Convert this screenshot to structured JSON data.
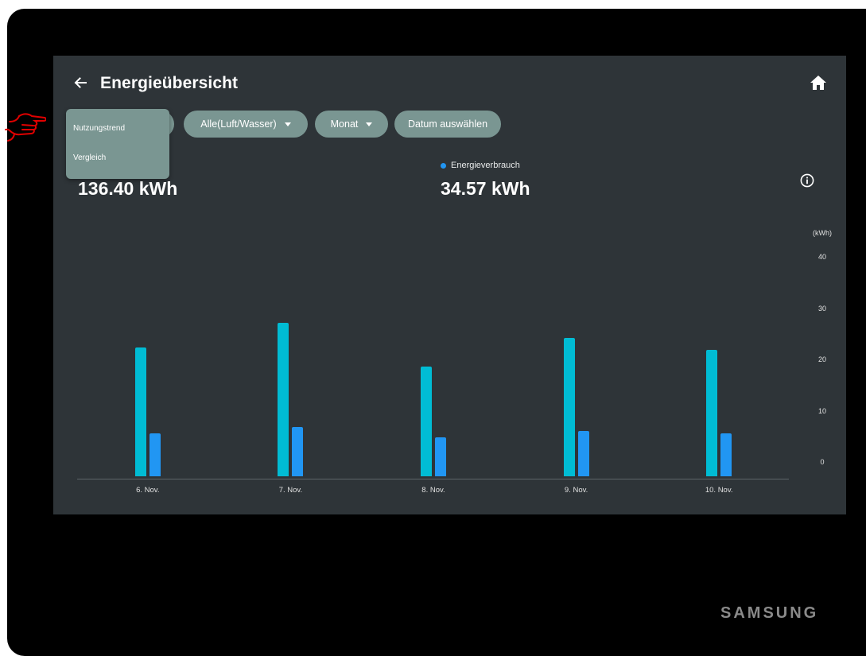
{
  "header": {
    "title": "Energieübersicht",
    "back_icon": "arrow-left-icon",
    "home_icon": "home-icon"
  },
  "filters": {
    "dropdown_menu": {
      "items": [
        "Nutzungstrend",
        "Vergleich"
      ]
    },
    "unit_filter": "Alle(Luft/Wasser)",
    "period_filter": "Monat",
    "date_button": "Datum auswählen"
  },
  "stats": {
    "left_value": "136.40 kWh",
    "right_label": "Energieverbrauch",
    "right_value": "34.57 kWh",
    "info_icon": "info-icon"
  },
  "chart_data": {
    "type": "bar",
    "categories": [
      "6. Nov.",
      "7. Nov.",
      "8. Nov.",
      "9. Nov.",
      "10. Nov."
    ],
    "series": [
      {
        "values": [
          22.5,
          27.3,
          18.7,
          24.4,
          22.0
        ]
      },
      {
        "name": "Energieverbrauch",
        "values": [
          5.7,
          6.9,
          5.0,
          6.2,
          5.7
        ]
      }
    ],
    "ylabel": "(kWh)",
    "yticks": [
      0,
      10,
      20,
      30,
      40
    ],
    "ylim": [
      0,
      40
    ],
    "y_axis_position": "right",
    "colors": [
      "#00bcd4",
      "#2196f3"
    ]
  },
  "brand": "SAMSUNG",
  "annotation": {
    "pointer_icon": "hand-pointer-icon",
    "color": "#e00000"
  }
}
